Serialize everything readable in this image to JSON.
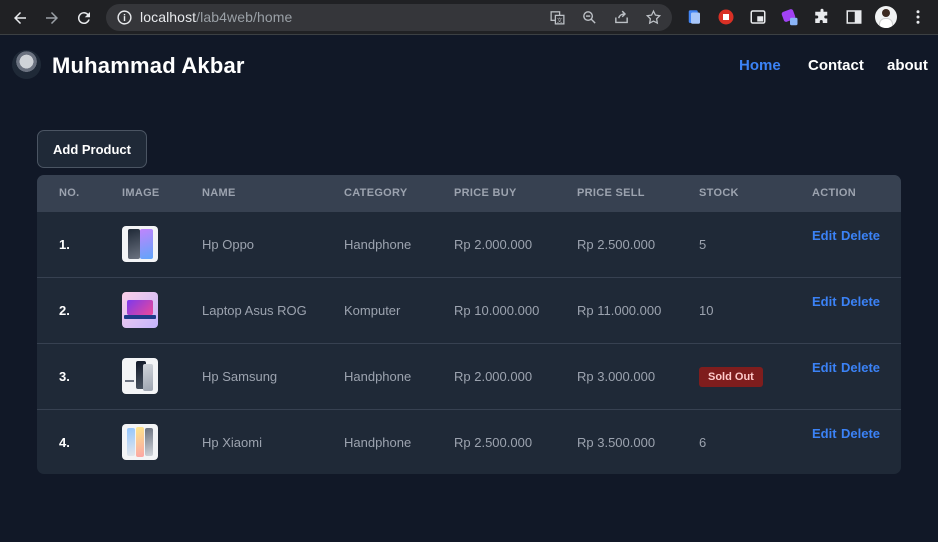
{
  "browser": {
    "url_host": "localhost",
    "url_path": "/lab4web/home",
    "icons": [
      "back-arrow-icon",
      "forward-arrow-icon",
      "reload-icon",
      "info-icon",
      "translate-icon",
      "zoom-icon",
      "share-icon",
      "bookmark-star-icon",
      "extension-icon",
      "puzzle-icon",
      "sidebar-icon",
      "profile-avatar"
    ]
  },
  "header": {
    "brand": "Muhammad Akbar",
    "nav": [
      {
        "label": "Home",
        "active": true
      },
      {
        "label": "Contact",
        "active": false
      },
      {
        "label": "about",
        "active": false
      }
    ]
  },
  "toolbar": {
    "add_label": "Add Product"
  },
  "table": {
    "columns": [
      "NO.",
      "IMAGE",
      "NAME",
      "CATEGORY",
      "PRICE BUY",
      "PRICE SELL",
      "STOCK",
      "ACTION"
    ],
    "rows": [
      {
        "no": "1.",
        "name": "Hp Oppo",
        "category": "Handphone",
        "price_buy": "Rp 2.000.000",
        "price_sell": "Rp 2.500.000",
        "stock": "5",
        "sold_out": false
      },
      {
        "no": "2.",
        "name": "Laptop Asus ROG",
        "category": "Komputer",
        "price_buy": "Rp 10.000.000",
        "price_sell": "Rp 11.000.000",
        "stock": "10",
        "sold_out": false
      },
      {
        "no": "3.",
        "name": "Hp Samsung",
        "category": "Handphone",
        "price_buy": "Rp 2.000.000",
        "price_sell": "Rp 3.000.000",
        "stock": "Sold Out",
        "sold_out": true
      },
      {
        "no": "4.",
        "name": "Hp Xiaomi",
        "category": "Handphone",
        "price_buy": "Rp 2.500.000",
        "price_sell": "Rp 3.500.000",
        "stock": "6",
        "sold_out": false
      }
    ],
    "actions": {
      "edit": "Edit",
      "delete": "Delete"
    }
  },
  "colors": {
    "page_bg": "#111827",
    "table_bg": "#1f2937",
    "header_bg": "#374151",
    "accent": "#3b82f6",
    "sold_out_bg": "#7f1d1d"
  }
}
